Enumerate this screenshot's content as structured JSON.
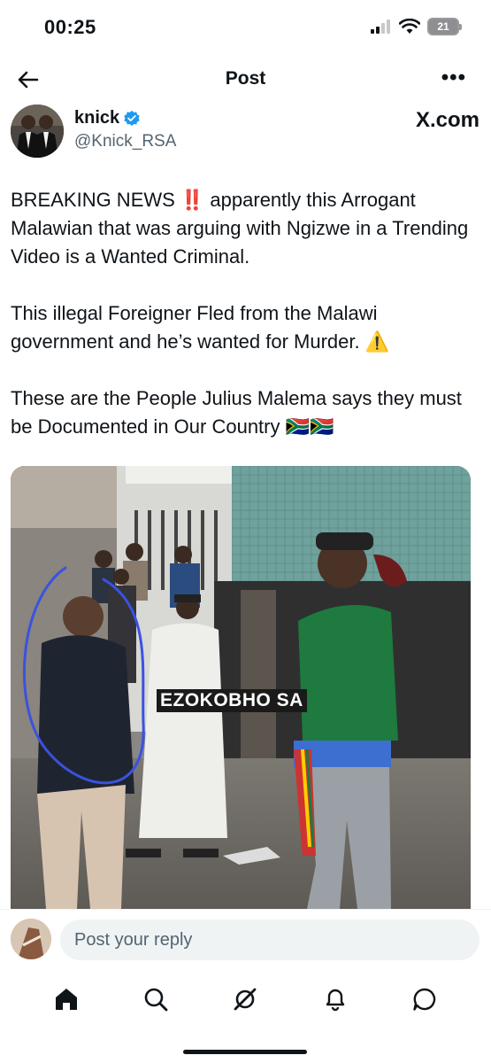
{
  "status_bar": {
    "time": "00:25",
    "battery": "21"
  },
  "nav": {
    "title": "Post"
  },
  "author": {
    "name": "knick",
    "handle": "@Knick_RSA",
    "source": "X.com"
  },
  "post": {
    "paragraph_1": "BREAKING NEWS ‼️ apparently this Arrogant Malawian that was arguing with Ngizwe in a Trending Video is a Wanted Criminal.",
    "paragraph_2": "This illegal Foreigner Fled from the Malawi government and he’s wanted for Murder. ⚠️",
    "paragraph_3": "These are the People Julius Malema says they must be Documented in Our Country 🇿🇦🇿🇦"
  },
  "media": {
    "caption": "EZOKOBHO SA"
  },
  "reply": {
    "placeholder": "Post your reply"
  },
  "bottom_nav": {
    "items": [
      "home-icon",
      "search-icon",
      "grok-icon",
      "notifications-icon",
      "messages-icon"
    ]
  },
  "colors": {
    "accent": "#1d9bf0",
    "text": "#0f1419",
    "secondary": "#536471"
  }
}
